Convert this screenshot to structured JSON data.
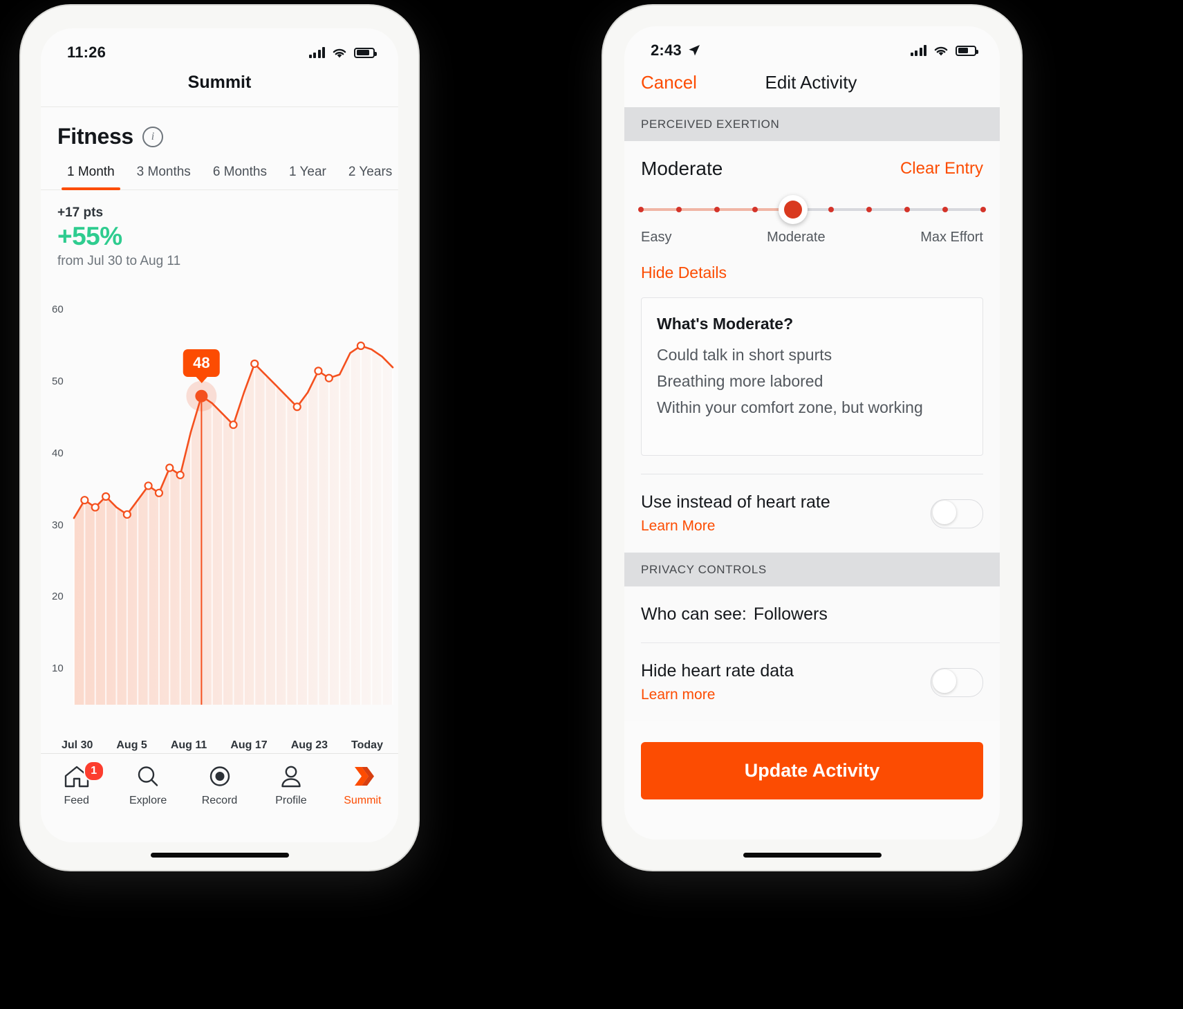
{
  "left_phone": {
    "status_bar": {
      "time": "11:26",
      "signal_icon": "cellular-bars-icon",
      "wifi_icon": "wifi-icon",
      "battery_icon": "battery-icon"
    },
    "nav_title": "Summit",
    "section": {
      "title": "Fitness",
      "info_icon": "info-circle-icon"
    },
    "tabs": [
      {
        "label": "1 Month",
        "active": true
      },
      {
        "label": "3 Months",
        "active": false
      },
      {
        "label": "6 Months",
        "active": false
      },
      {
        "label": "1 Year",
        "active": false
      },
      {
        "label": "2 Years",
        "active": false
      }
    ],
    "stats": {
      "points": "+17 pts",
      "percent": "+55%",
      "range": "from Jul 30 to Aug 11",
      "percent_color": "#2ecc8f"
    },
    "tooltip_value": "48",
    "tabbar": [
      {
        "label": "Feed",
        "icon": "home-icon",
        "badge": "1",
        "active": false
      },
      {
        "label": "Explore",
        "icon": "search-icon",
        "badge": "",
        "active": false
      },
      {
        "label": "Record",
        "icon": "record-icon",
        "badge": "",
        "active": false
      },
      {
        "label": "Profile",
        "icon": "person-icon",
        "badge": "",
        "active": false
      },
      {
        "label": "Summit",
        "icon": "double-chevron-icon",
        "badge": "",
        "active": true
      }
    ]
  },
  "chart_data": {
    "type": "area",
    "title": "Fitness",
    "xlabel": "",
    "ylabel": "",
    "ylim": [
      5,
      63
    ],
    "yticks": [
      10,
      20,
      30,
      40,
      50,
      60
    ],
    "xtick_labels": [
      "Jul 30",
      "Aug 5",
      "Aug 11",
      "Aug 17",
      "Aug 23",
      "Today"
    ],
    "grid": false,
    "line_color": "#f4501e",
    "fill_color": "#fbd9cc",
    "highlight": {
      "index": 12,
      "value": 48,
      "label": "48",
      "date": "Aug 11"
    },
    "x": [
      "Jul 30",
      "Jul 31",
      "Aug 1",
      "Aug 2",
      "Aug 3",
      "Aug 4",
      "Aug 5",
      "Aug 6",
      "Aug 7",
      "Aug 8",
      "Aug 9",
      "Aug 10",
      "Aug 11",
      "Aug 12",
      "Aug 13",
      "Aug 14",
      "Aug 15",
      "Aug 16",
      "Aug 17",
      "Aug 18",
      "Aug 19",
      "Aug 20",
      "Aug 21",
      "Aug 22",
      "Aug 23",
      "Aug 24",
      "Aug 25",
      "Aug 26",
      "Aug 27",
      "Aug 28",
      "Today"
    ],
    "values": [
      31,
      33.5,
      32.5,
      34,
      32.5,
      31.5,
      33.5,
      35.5,
      34.5,
      38,
      37,
      43,
      48,
      47,
      45.5,
      44,
      48.5,
      52.5,
      51,
      49.5,
      48,
      46.5,
      48.5,
      51.5,
      50.5,
      51,
      54,
      55,
      54.5,
      53.5,
      52
    ]
  },
  "right_phone": {
    "status_bar": {
      "time": "2:43",
      "location_icon": "location-arrow-icon",
      "signal_icon": "cellular-bars-icon",
      "wifi_icon": "wifi-icon",
      "battery_icon": "battery-icon"
    },
    "nav": {
      "cancel": "Cancel",
      "title": "Edit Activity"
    },
    "exertion_group_header": "PERCEIVED EXERTION",
    "exertion": {
      "value_label": "Moderate",
      "clear_entry": "Clear Entry",
      "slider": {
        "steps": 10,
        "selected_index": 4,
        "left_label": "Easy",
        "center_label": "Moderate",
        "right_label": "Max Effort"
      },
      "toggle_details_label": "Hide Details",
      "details": {
        "heading": "What's Moderate?",
        "lines": [
          "Could talk in short spurts",
          "Breathing more labored",
          "Within your comfort zone, but working"
        ]
      }
    },
    "heart_rate_row": {
      "title": "Use instead of heart rate",
      "link": "Learn More",
      "toggle_on": false
    },
    "privacy_group_header": "PRIVACY CONTROLS",
    "who_can_see": {
      "label": "Who can see:",
      "value": "Followers"
    },
    "hide_hr_row": {
      "title": "Hide heart rate data",
      "link": "Learn more",
      "toggle_on": false
    },
    "update_button": "Update Activity"
  },
  "colors": {
    "accent": "#fc4c02",
    "green": "#2ecc8f",
    "badge_red": "#fc3d2e"
  }
}
